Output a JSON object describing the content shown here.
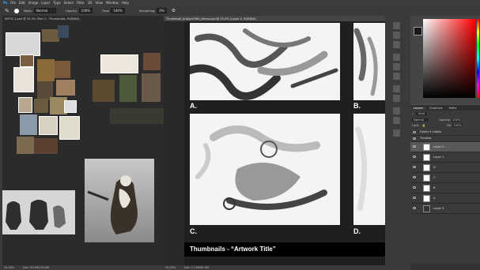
{
  "menu": [
    "Ps",
    "File",
    "Edit",
    "Image",
    "Layer",
    "Type",
    "Select",
    "Filter",
    "3D",
    "View",
    "Window",
    "Help"
  ],
  "options": {
    "mode_label": "Mode:",
    "mode_value": "Normal",
    "opacity_label": "Opacity:",
    "opacity_value": "100%",
    "flow_label": "Flow:",
    "flow_value": "100%",
    "smoothing_label": "Smoothing:",
    "smoothing_value": "0%"
  },
  "doc1": {
    "tab": "INFOS 1.psd @ 33.3% (Part 1 - Thumbnails, RGB/8#)",
    "zoom": "33.33%",
    "info": "Doc: 93.0M/133.4M"
  },
  "doc2": {
    "tab": "Thumbnail_ArtworkTitle_Demo.psd @ 25.0% (Layer 2, RGB/8#)",
    "zoom": "25.00%",
    "info": "Doc: 17.2M/60.5M",
    "panels": [
      {
        "label": "A."
      },
      {
        "label": "B."
      },
      {
        "label": "C."
      },
      {
        "label": "D."
      }
    ],
    "footer": "Thumbnails - “Artwork Title”"
  },
  "layers_panel": {
    "tabs": [
      "Layers",
      "Channels",
      "Paths"
    ],
    "kind_label": "Kind",
    "blend_mode": "Normal",
    "opacity_label": "Opacity:",
    "opacity_value": "100%",
    "lock_label": "Lock:",
    "fill_label": "Fill:",
    "fill_value": "100%",
    "layers": [
      {
        "name": "Folder 4 Labels"
      },
      {
        "name": "Thumbs"
      },
      {
        "name": "Layer 2"
      },
      {
        "name": "Layer 1"
      },
      {
        "name": "D"
      },
      {
        "name": "C"
      },
      {
        "name": "B"
      },
      {
        "name": "A"
      },
      {
        "name": "Layer 3"
      }
    ]
  },
  "colors": {
    "picker_hue": "#ff0000",
    "fg": "#1a1a1a",
    "bg": "#ffffff"
  }
}
